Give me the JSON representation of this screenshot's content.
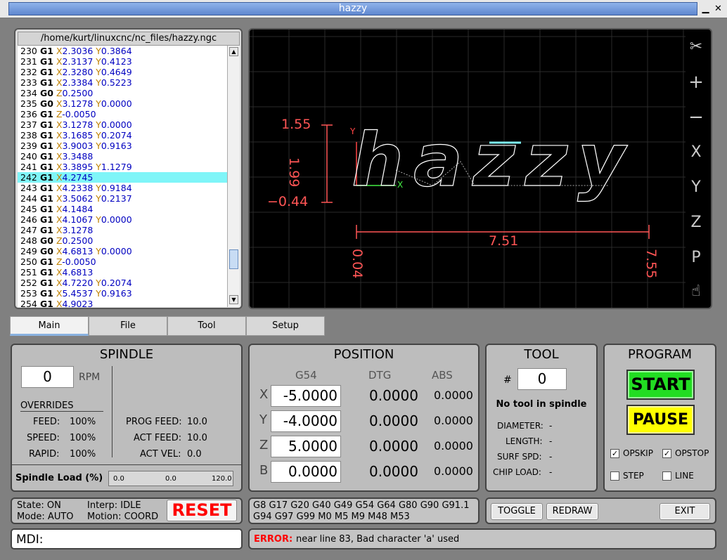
{
  "window": {
    "title": "hazzy",
    "min": "▁",
    "max": "□",
    "close": "✕"
  },
  "code": {
    "path": "/home/kurt/linuxcnc/nc_files/hazzy.ngc",
    "lines": [
      {
        "n": "230",
        "g": "G1",
        "a1": "X",
        "v1": "2.3036",
        "a2": "Y",
        "v2": "0.3864"
      },
      {
        "n": "231",
        "g": "G1",
        "a1": "X",
        "v1": "2.3137",
        "a2": "Y",
        "v2": "0.4123"
      },
      {
        "n": "232",
        "g": "G1",
        "a1": "X",
        "v1": "2.3280",
        "a2": "Y",
        "v2": "0.4649"
      },
      {
        "n": "233",
        "g": "G1",
        "a1": "X",
        "v1": "2.3384",
        "a2": "Y",
        "v2": "0.5223"
      },
      {
        "n": "234",
        "g": "G0",
        "a1": "Z",
        "v1": "0.2500",
        "a2": "",
        "v2": ""
      },
      {
        "n": "235",
        "g": "G0",
        "a1": "X",
        "v1": "3.1278",
        "a2": "Y",
        "v2": "0.0000"
      },
      {
        "n": "236",
        "g": "G1",
        "a1": "Z",
        "v1": "-0.0050",
        "a2": "",
        "v2": ""
      },
      {
        "n": "237",
        "g": "G1",
        "a1": "X",
        "v1": "3.1278",
        "a2": "Y",
        "v2": "0.0000"
      },
      {
        "n": "238",
        "g": "G1",
        "a1": "X",
        "v1": "3.1685",
        "a2": "Y",
        "v2": "0.2074"
      },
      {
        "n": "239",
        "g": "G1",
        "a1": "X",
        "v1": "3.9003",
        "a2": "Y",
        "v2": "0.9163"
      },
      {
        "n": "240",
        "g": "G1",
        "a1": "X",
        "v1": "3.3488",
        "a2": "",
        "v2": ""
      },
      {
        "n": "241",
        "g": "G1",
        "a1": "X",
        "v1": "3.3895",
        "a2": "Y",
        "v2": "1.1279"
      },
      {
        "n": "242",
        "g": "G1",
        "a1": "X",
        "v1": "4.2745",
        "a2": "",
        "v2": "",
        "hl": true
      },
      {
        "n": "243",
        "g": "G1",
        "a1": "X",
        "v1": "4.2338",
        "a2": "Y",
        "v2": "0.9184"
      },
      {
        "n": "244",
        "g": "G1",
        "a1": "X",
        "v1": "3.5062",
        "a2": "Y",
        "v2": "0.2137"
      },
      {
        "n": "245",
        "g": "G1",
        "a1": "X",
        "v1": "4.1484",
        "a2": "",
        "v2": ""
      },
      {
        "n": "246",
        "g": "G1",
        "a1": "X",
        "v1": "4.1067",
        "a2": "Y",
        "v2": "0.0000"
      },
      {
        "n": "247",
        "g": "G1",
        "a1": "X",
        "v1": "3.1278",
        "a2": "",
        "v2": ""
      },
      {
        "n": "248",
        "g": "G0",
        "a1": "Z",
        "v1": "0.2500",
        "a2": "",
        "v2": ""
      },
      {
        "n": "249",
        "g": "G0",
        "a1": "X",
        "v1": "4.6813",
        "a2": "Y",
        "v2": "0.0000"
      },
      {
        "n": "250",
        "g": "G1",
        "a1": "Z",
        "v1": "-0.0050",
        "a2": "",
        "v2": ""
      },
      {
        "n": "251",
        "g": "G1",
        "a1": "X",
        "v1": "4.6813",
        "a2": "",
        "v2": ""
      },
      {
        "n": "252",
        "g": "G1",
        "a1": "X",
        "v1": "4.7220",
        "a2": "Y",
        "v2": "0.2074"
      },
      {
        "n": "253",
        "g": "G1",
        "a1": "X",
        "v1": "5.4537",
        "a2": "Y",
        "v2": "0.9163"
      },
      {
        "n": "254",
        "g": "G1",
        "a1": "X",
        "v1": "4.9023",
        "a2": "",
        "v2": ""
      }
    ]
  },
  "plot": {
    "dim_y_top": "1.55",
    "dim_y_bottom": "−0.44",
    "dim_y_span": "1.99",
    "dim_x_left": "0.04",
    "dim_x_right": "7.55",
    "dim_x_span": "7.51",
    "text": "hazzy",
    "axis_x": "X",
    "axis_y": "Y",
    "toolbar": {
      "measure": "✂",
      "zoom_in": "+",
      "zoom_out": "−",
      "view_x": "X",
      "view_y": "Y",
      "view_z": "Z",
      "view_p": "P",
      "pan": "☝"
    }
  },
  "tabs": [
    "Main",
    "File",
    "Tool",
    "Setup"
  ],
  "spindle": {
    "title": "SPINDLE",
    "rpm_value": "0",
    "rpm_label": "RPM",
    "overrides_label": "OVERRIDES",
    "feed_label": "FEED:",
    "feed": "100%",
    "speed_label": "SPEED:",
    "speed": "100%",
    "rapid_label": "RAPID:",
    "rapid": "100%",
    "prog_feed_label": "PROG FEED:",
    "prog_feed": "10.0",
    "act_feed_label": "ACT FEED:",
    "act_feed": "10.0",
    "act_vel_label": "ACT VEL:",
    "act_vel": "0.0",
    "load_label": "Spindle Load (%)",
    "load_min": "0.0",
    "load_cur": "0.0",
    "load_max": "120.0"
  },
  "position": {
    "title": "POSITION",
    "col_g54": "G54",
    "col_dtg": "DTG",
    "col_abs": "ABS",
    "rows": [
      {
        "axis": "X",
        "g54": "-5.0000",
        "dtg": "0.0000",
        "abs": "0.0000"
      },
      {
        "axis": "Y",
        "g54": "-4.0000",
        "dtg": "0.0000",
        "abs": "0.0000"
      },
      {
        "axis": "Z",
        "g54": "5.0000",
        "dtg": "0.0000",
        "abs": "0.0000"
      },
      {
        "axis": "B",
        "g54": "0.0000",
        "dtg": "0.0000",
        "abs": "0.0000"
      }
    ]
  },
  "tool": {
    "title": "TOOL",
    "hash": "#",
    "number": "0",
    "status": "No tool in spindle",
    "diameter_label": "DIAMETER:",
    "diameter": "-",
    "length_label": "LENGTH:",
    "length": "-",
    "surf_label": "SURF SPD:",
    "surf": "-",
    "chip_label": "CHIP LOAD:",
    "chip": "-"
  },
  "program": {
    "title": "PROGRAM",
    "start": "START",
    "pause": "PAUSE",
    "opskip": "OPSKIP",
    "opstop": "OPSTOP",
    "step": "STEP",
    "line": "LINE",
    "check": "✓"
  },
  "status": {
    "state": "State: ON",
    "mode": "Mode: AUTO",
    "interp": "Interp: IDLE",
    "motion": "Motion: COORD",
    "reset": "RESET"
  },
  "gcodes": {
    "line1": "G8 G17 G20 G40 G49 G54 G64 G80 G90 G91.1",
    "line2": "G94 G97 G99 M0 M5 M9 M48 M53"
  },
  "buttons": {
    "toggle": "TOGGLE",
    "redraw": "REDRAW",
    "exit": "EXIT"
  },
  "mdi": {
    "label": "MDI:"
  },
  "error": {
    "label": "ERROR:",
    "message": "near line 83, Bad character 'a' used"
  },
  "colors": {
    "highlight": "#7ff5f8",
    "start": "#22dd22",
    "pause": "#ffff00",
    "reset": "#ff0000",
    "dim": "#ff5555"
  }
}
